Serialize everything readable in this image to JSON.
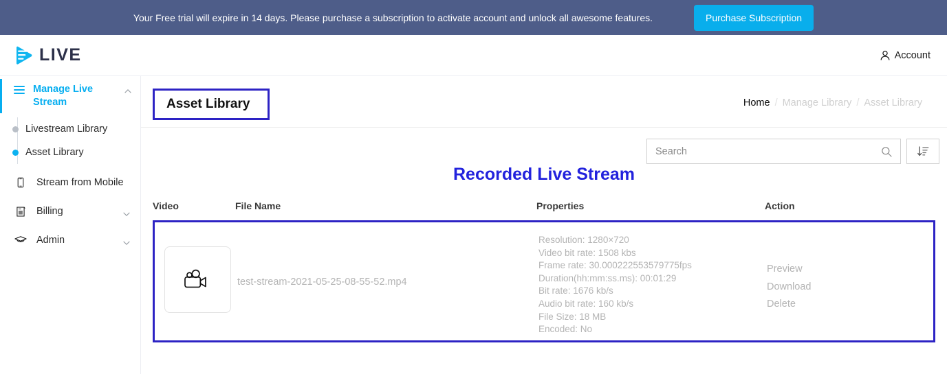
{
  "banner": {
    "message": "Your Free trial will expire in 14 days. Please purchase a subscription to activate account and unlock all awesome features.",
    "cta_label": "Purchase Subscription",
    "bg_color": "#4e5d89",
    "cta_color": "#09aeec"
  },
  "header": {
    "logo_text": "LIVE",
    "logo_icon": "play-wave-logo-icon",
    "account_label": "Account",
    "account_icon": "user-icon"
  },
  "sidebar": {
    "group": {
      "label": "Manage Live Stream",
      "icon": "hamburger-icon",
      "chevron": "chevron-up-icon",
      "active_color": "#06aef0",
      "children": [
        {
          "label": "Livestream Library",
          "active": false
        },
        {
          "label": "Asset Library",
          "active": true
        }
      ]
    },
    "items": [
      {
        "label": "Stream from Mobile",
        "icon": "mobile-phone-icon",
        "chevron": ""
      },
      {
        "label": "Billing",
        "icon": "invoice-icon",
        "chevron": "chevron-down-icon"
      },
      {
        "label": "Admin",
        "icon": "graduation-cap-icon",
        "chevron": "chevron-down-icon"
      }
    ]
  },
  "page": {
    "title": "Asset Library",
    "highlight_color": "#2d23c4",
    "breadcrumb": [
      {
        "label": "Home",
        "muted": false
      },
      {
        "label": "Manage Library",
        "muted": true
      },
      {
        "label": "Asset Library",
        "muted": true
      }
    ],
    "breadcrumb_separator": "/"
  },
  "toolbar": {
    "search_placeholder": "Search",
    "search_value": "",
    "search_icon": "search-icon",
    "sort_icon": "sort-amount-down-icon"
  },
  "table": {
    "section_title": "Recorded Live Stream",
    "section_title_color": "#2222dd",
    "columns": [
      "Video",
      "File Name",
      "Properties",
      "Action"
    ],
    "rows": [
      {
        "thumb_icon": "video-camera-icon",
        "file_name": "test-stream-2021-05-25-08-55-52.mp4",
        "properties": [
          "Resolution: 1280×720",
          "Video bit rate: 1508 kbs",
          "Frame rate: 30.000222553579775fps",
          "Duration(hh:mm:ss.ms): 00:01:29",
          "Bit rate: 1676 kb/s",
          "Audio bit rate: 160 kb/s",
          "File Size: 18 MB",
          "Encoded: No"
        ],
        "actions": [
          "Preview",
          "Download",
          "Delete"
        ]
      }
    ]
  }
}
